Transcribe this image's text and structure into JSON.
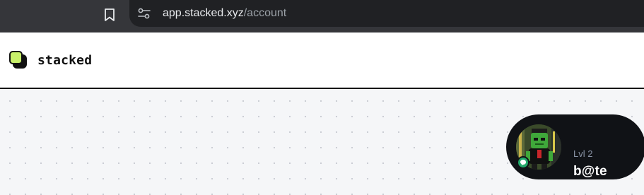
{
  "browser": {
    "url_host": "app.stacked.xyz",
    "url_path": "/account"
  },
  "header": {
    "brand_name": "stacked",
    "logo_icon": "stacked-squares-logo",
    "accent_color": "#c8f06a"
  },
  "profile": {
    "level": "Lvl 2",
    "username": "b@te",
    "badge_icon": "chat-bubble-icon",
    "badge_color": "#22a76a"
  }
}
